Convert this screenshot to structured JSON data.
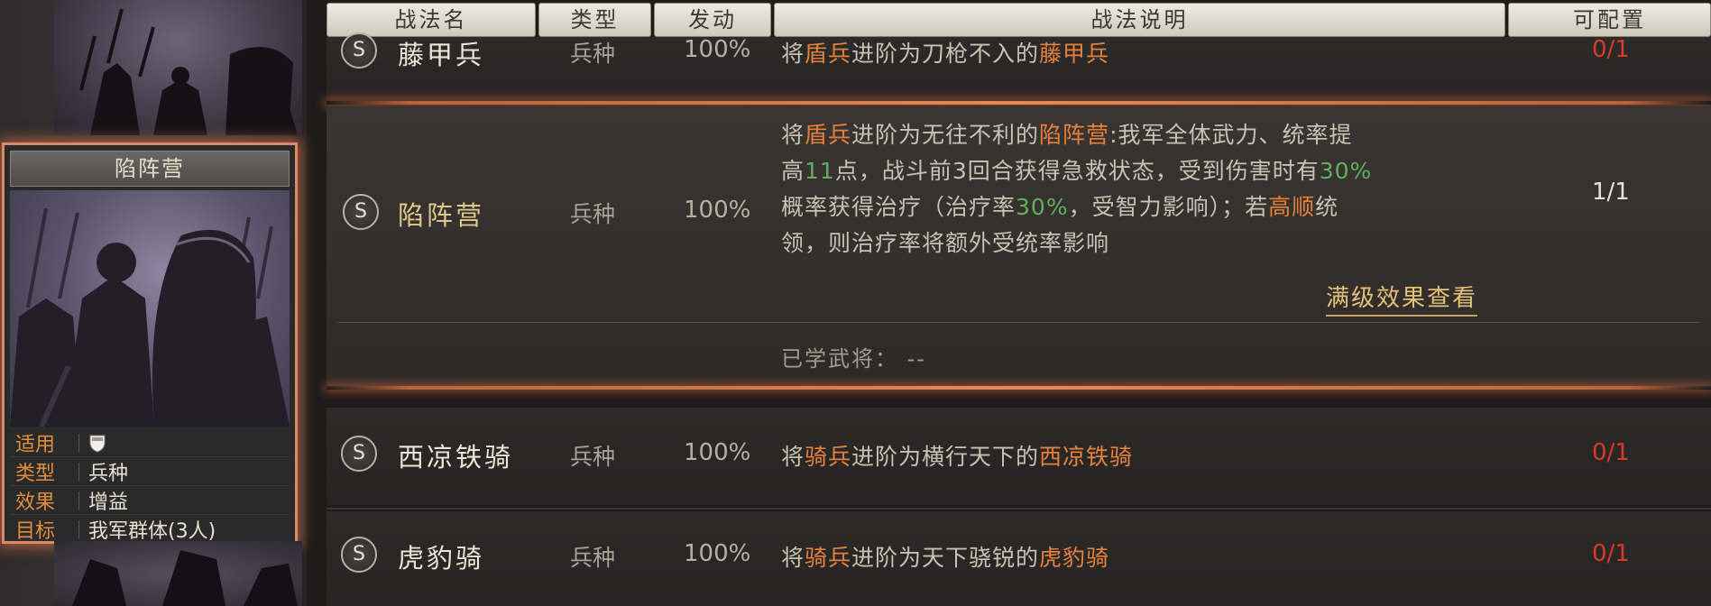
{
  "header": {
    "col_name": "战法名",
    "col_type": "类型",
    "col_trigger": "发动",
    "col_desc": "战法说明",
    "col_config": "可配置"
  },
  "card": {
    "title": "陷阵营",
    "stats": [
      {
        "key": "适用",
        "value": ""
      },
      {
        "key": "类型",
        "value": "兵种"
      },
      {
        "key": "效果",
        "value": "增益"
      },
      {
        "key": "目标",
        "value": "我军群体(3人)"
      }
    ]
  },
  "rows": [
    {
      "badge": "S",
      "name": "藤甲兵",
      "type": "兵种",
      "trigger": "100%",
      "desc": {
        "p1": "将",
        "h1": "盾兵",
        "p2": "进阶为刀枪不入的",
        "h2": "藤甲兵"
      },
      "config": "0/1"
    },
    {
      "badge": "S",
      "name": "陷阵营",
      "type": "兵种",
      "trigger": "100%",
      "desc": {
        "l1a": "将",
        "l1b": "盾兵",
        "l1c": "进阶为无往不利的",
        "l1d": "陷阵营",
        "l1e": ":我军全体武力、统率提",
        "l2a": "高",
        "l2b": "11",
        "l2c": "点，战斗前3回合获得急救状态，受到伤害时有",
        "l2d": "30%",
        "l3a": "概率获得治疗（治疗率",
        "l3b": "30%",
        "l3c": "，受智力影响）；若",
        "l3d": "高顺",
        "l3e": "统",
        "l4": "领，则治疗率将额外受统率影响"
      },
      "config": "1/1",
      "max_level_link": "满级效果查看",
      "learned_label": "已学武将：",
      "learned_value": "--"
    },
    {
      "badge": "S",
      "name": "西凉铁骑",
      "type": "兵种",
      "trigger": "100%",
      "desc": {
        "p1": "将",
        "h1": "骑兵",
        "p2": "进阶为横行天下的",
        "h2": "西凉铁骑"
      },
      "config": "0/1"
    },
    {
      "badge": "S",
      "name": "虎豹骑",
      "type": "兵种",
      "trigger": "100%",
      "desc": {
        "p1": "将",
        "h1": "骑兵",
        "p2": "进阶为天下骁锐的",
        "h2": "虎豹骑"
      },
      "config": "0/1"
    }
  ],
  "colors": {
    "highlight_orange": "#e6813a",
    "highlight_green": "#62b05c",
    "config_red": "#d53a2a",
    "selection_glow": "#e58a58"
  }
}
